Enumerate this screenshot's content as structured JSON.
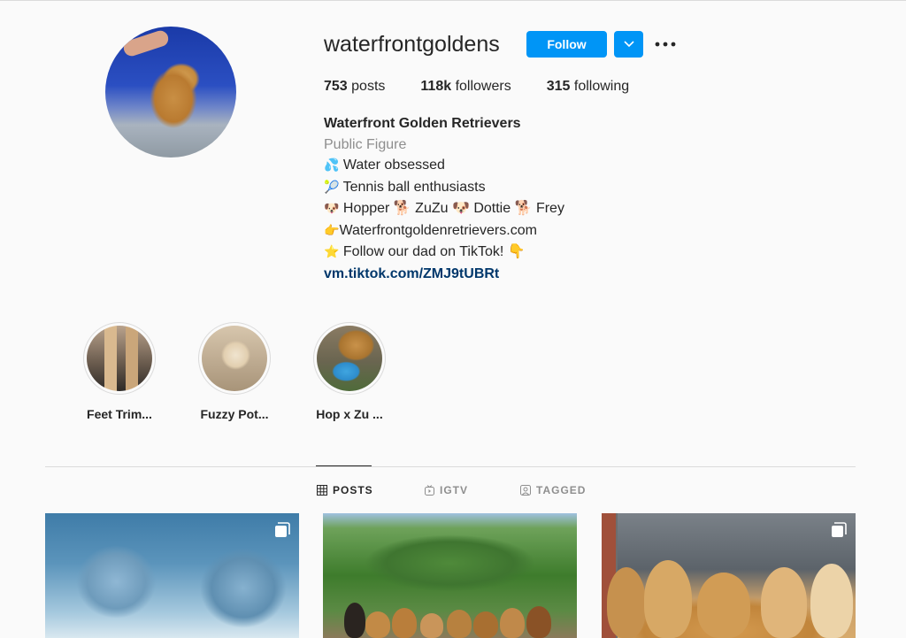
{
  "profile": {
    "username": "waterfrontgoldens",
    "follow_label": "Follow",
    "stats": [
      {
        "count": "753",
        "label": "posts"
      },
      {
        "count": "118k",
        "label": "followers"
      },
      {
        "count": "315",
        "label": "following"
      }
    ],
    "bio": {
      "full_name": "Waterfront Golden Retrievers",
      "category": "Public Figure",
      "lines": [
        {
          "emoji": "💦",
          "text": "Water obsessed"
        },
        {
          "emoji": "🎾",
          "text": "Tennis ball enthusiasts"
        },
        {
          "emoji": "🐶",
          "text": "Hopper 🐕 ZuZu 🐶 Dottie 🐕 Frey"
        },
        {
          "emoji": "👉",
          "text": "Waterfrontgoldenretrievers.com"
        },
        {
          "emoji": "⭐",
          "text": "Follow our dad on TikTok! 👇"
        }
      ],
      "link": "vm.tiktok.com/ZMJ9tUBRt"
    }
  },
  "highlights": [
    {
      "label": "Feet Trim..."
    },
    {
      "label": "Fuzzy Pot..."
    },
    {
      "label": "Hop x Zu ..."
    }
  ],
  "tabs": [
    {
      "label": "POSTS",
      "icon": "grid-icon",
      "active": true
    },
    {
      "label": "IGTV",
      "icon": "igtv-icon",
      "active": false
    },
    {
      "label": "TAGGED",
      "icon": "tagged-icon",
      "active": false
    }
  ],
  "colors": {
    "accent": "#0095f6",
    "link": "#00376b",
    "muted": "#8e8e8e",
    "border": "#dbdbdb",
    "background": "#fafafa"
  }
}
